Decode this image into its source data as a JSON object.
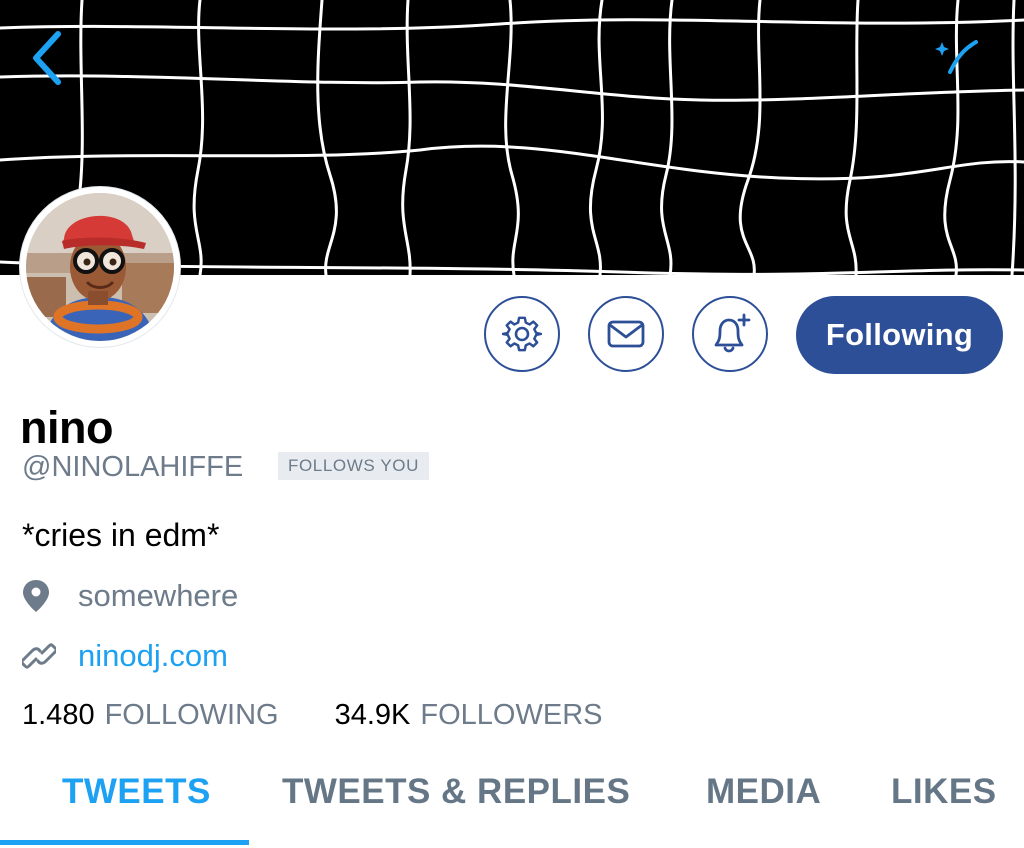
{
  "profile": {
    "display_name": "nino",
    "handle": "@NINOLAHIFFE",
    "follows_you": "FOLLOWS YOU",
    "bio": "*cries in edm*",
    "location": "somewhere",
    "website": "ninodj.com"
  },
  "actions": {
    "following_label": "Following",
    "icons": [
      "gear-icon",
      "mail-icon",
      "bell-plus-icon"
    ]
  },
  "stats": {
    "following_count": "1.480",
    "following_label": "FOLLOWING",
    "followers_count": "34.9K",
    "followers_label": "FOLLOWERS"
  },
  "tabs": [
    {
      "label": "TWEETS",
      "active": true
    },
    {
      "label": "TWEETS & REPLIES",
      "active": false
    },
    {
      "label": "MEDIA",
      "active": false
    },
    {
      "label": "LIKES",
      "active": false
    }
  ],
  "colors": {
    "accent": "#1da1f2",
    "button_blue": "#2c4f97",
    "muted": "#6d7b8a",
    "banner_bg": "#000000"
  }
}
